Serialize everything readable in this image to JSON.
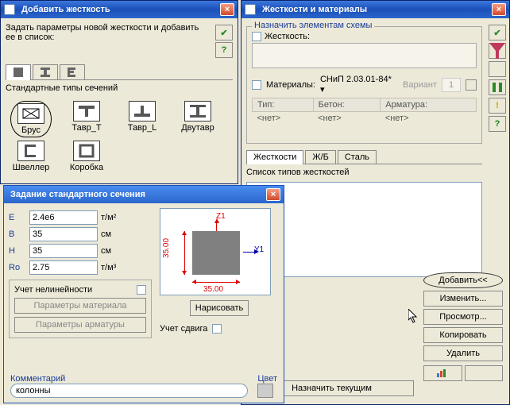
{
  "addWindow": {
    "title": "Добавить жесткость",
    "instruction": "Задать параметры новой жесткости и добавить ее в список:",
    "sectionTypesLabel": "Стандартные типы сечений",
    "icons": {
      "brus": "Брус",
      "tavr_t": "Тавр_T",
      "tavr_l": "Тавр_L",
      "dvutavr": "Двутавр",
      "shveller": "Швеллер",
      "korobka": "Коробка"
    },
    "helpSymbol": "?"
  },
  "rigidWindow": {
    "title": "Жесткости и материалы",
    "assignGroup": "Назначить элементам схемы",
    "rigidityLabel": "Жесткость:",
    "materialsLabel": "Материалы:",
    "materialsValue": "СНиП 2.03.01-84* ▾",
    "variantLabel": "Вариант",
    "variantValue": "1",
    "cols": {
      "type": "Тип:",
      "beton": "Бетон:",
      "arm": "Арматура:"
    },
    "vals": {
      "type": "<нет>",
      "beton": "<нет>",
      "arm": "<нет>"
    },
    "tabs": {
      "rigid": "Жесткости",
      "rc": "Ж/Б",
      "steel": "Сталь"
    },
    "listLabel": "Список типов жесткостей",
    "buttons": {
      "add": "Добавить<<",
      "edit": "Изменить...",
      "view": "Просмотр...",
      "copy": "Копировать",
      "del": "Удалить"
    },
    "setCurrent": "Назначить текущим",
    "helpSymbol": "?"
  },
  "sectionDialog": {
    "title": "Задание стандартного сечения",
    "E": {
      "label": "E",
      "value": "2.4e6",
      "unit": "т/м²"
    },
    "B": {
      "label": "B",
      "value": "35",
      "unit": "см"
    },
    "H": {
      "label": "H",
      "value": "35",
      "unit": "см"
    },
    "Ro": {
      "label": "Ro",
      "value": "2.75",
      "unit": "т/м³"
    },
    "nonlin": "Учет нелинейности",
    "matParams": "Параметры материала",
    "armParams": "Параметры арматуры",
    "shear": "Учет сдвига",
    "draw": "Нарисовать",
    "commentLabel": "Комментарий",
    "commentValue": "колонны",
    "colorLabel": "Цвет",
    "axis": {
      "z": "Z1",
      "y": "Y1",
      "h": "35.00",
      "w": "35.00"
    }
  }
}
